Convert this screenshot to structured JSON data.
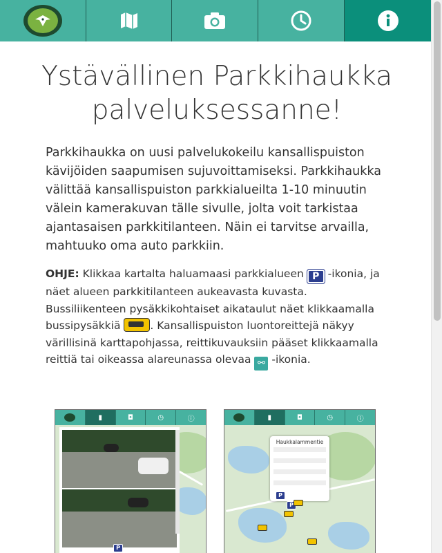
{
  "nav": {
    "tabs": [
      {
        "id": "home",
        "icon": "logo-badge",
        "active": false
      },
      {
        "id": "map",
        "icon": "map-icon",
        "active": false
      },
      {
        "id": "camera",
        "icon": "camera-icon",
        "active": false
      },
      {
        "id": "schedule",
        "icon": "clock-icon",
        "active": false
      },
      {
        "id": "info",
        "icon": "info-icon",
        "active": true
      }
    ],
    "colors": {
      "bar": "#47b2a0",
      "active": "#0b8f7b"
    }
  },
  "main": {
    "title": "Ystävällinen Parkkihaukka palveluksessanne!",
    "intro": "Parkkihaukka on uusi palvelukokeilu kansallispuiston kävijöiden saapumisen sujuvoittamiseksi. Parkkihaukka välittää kansallispuiston parkkialueilta 1-10 minuutin välein kamerakuvan tälle sivulle, jolta voit tarkistaa ajantasaisen parkkitilanteen. Näin ei tarvitse arvailla, mahtuuko oma auto parkkiin.",
    "howto": {
      "label": "OHJE:",
      "part1": " Klikkaa kartalta haluamaasi parkkialueen ",
      "parking_icon_text": "P",
      "part2": " -ikonia, ja näet alueen parkkitilanteen aukeavasta kuvasta. Bussiliikenteen pysäkkikohtaiset aikataulut näet klikkaamalla bussipysäkkiä ",
      "part3": ". Kansallispuiston luontoreittejä näkyy värillisinä karttapohjassa, reittikuvauksiin pääset klikkaamalla reittiä tai oikeassa alareunassa olevaa ",
      "part4": " -ikonia."
    }
  },
  "screenshots": {
    "popup_title": "Haukkalammentie",
    "parking_marker_text": "P"
  }
}
